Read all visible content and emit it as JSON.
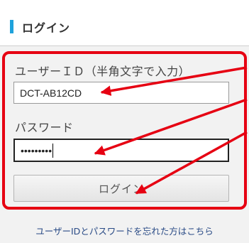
{
  "header": {
    "title": "ログイン"
  },
  "form": {
    "user_id_label": "ユーザーＩＤ（半角文字で入力）",
    "user_id_value": "DCT-AB12CD",
    "password_label": "パスワード",
    "password_value": "•••••••••",
    "login_button": "ログイン"
  },
  "forgot_link": "ユーザーIDとパスワードを忘れた方はこちら",
  "colors": {
    "accent": "#1ea2dc",
    "highlight": "#e60012",
    "link": "#2a4b86"
  }
}
